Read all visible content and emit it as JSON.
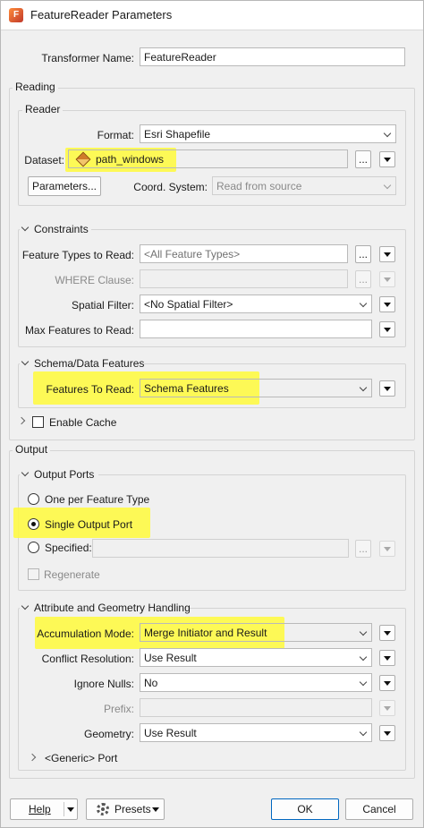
{
  "window": {
    "title": "FeatureReader Parameters"
  },
  "transformer": {
    "label": "Transformer Name:",
    "value": "FeatureReader"
  },
  "reading": {
    "legend": "Reading",
    "reader": {
      "legend": "Reader",
      "format_label": "Format:",
      "format_value": "Esri Shapefile",
      "dataset_label": "Dataset:",
      "dataset_value": "path_windows",
      "dataset_browse": "...",
      "parameters_button": "Parameters...",
      "coord_label": "Coord. System:",
      "coord_value": "Read from source"
    },
    "constraints": {
      "legend": "Constraints",
      "feature_types_label": "Feature Types to Read:",
      "feature_types_placeholder": "<All Feature Types>",
      "feature_types_browse": "...",
      "where_label": "WHERE Clause:",
      "where_browse": "...",
      "spatial_label": "Spatial Filter:",
      "spatial_value": "<No Spatial Filter>",
      "max_label": "Max Features to Read:"
    },
    "schema": {
      "legend": "Schema/Data Features",
      "features_label": "Features To Read:",
      "features_value": "Schema Features"
    },
    "cache": {
      "label": "Enable Cache"
    }
  },
  "output": {
    "legend": "Output",
    "ports": {
      "legend": "Output Ports",
      "option1": "One per Feature Type",
      "option2": "Single Output Port",
      "option3": "Specified:",
      "specified_browse": "...",
      "regenerate": "Regenerate"
    },
    "attr": {
      "legend": "Attribute and Geometry Handling",
      "accumulation_label": "Accumulation Mode:",
      "accumulation_value": "Merge Initiator and Result",
      "conflict_label": "Conflict Resolution:",
      "conflict_value": "Use Result",
      "nulls_label": "Ignore Nulls:",
      "nulls_value": "No",
      "prefix_label": "Prefix:",
      "geometry_label": "Geometry:",
      "geometry_value": "Use Result",
      "generic_port": "<Generic> Port"
    }
  },
  "footer": {
    "help": "Help",
    "presets": "Presets",
    "ok": "OK",
    "cancel": "Cancel"
  },
  "colors": {
    "highlight": "#fffa3b",
    "ok_border": "#0067c0"
  }
}
